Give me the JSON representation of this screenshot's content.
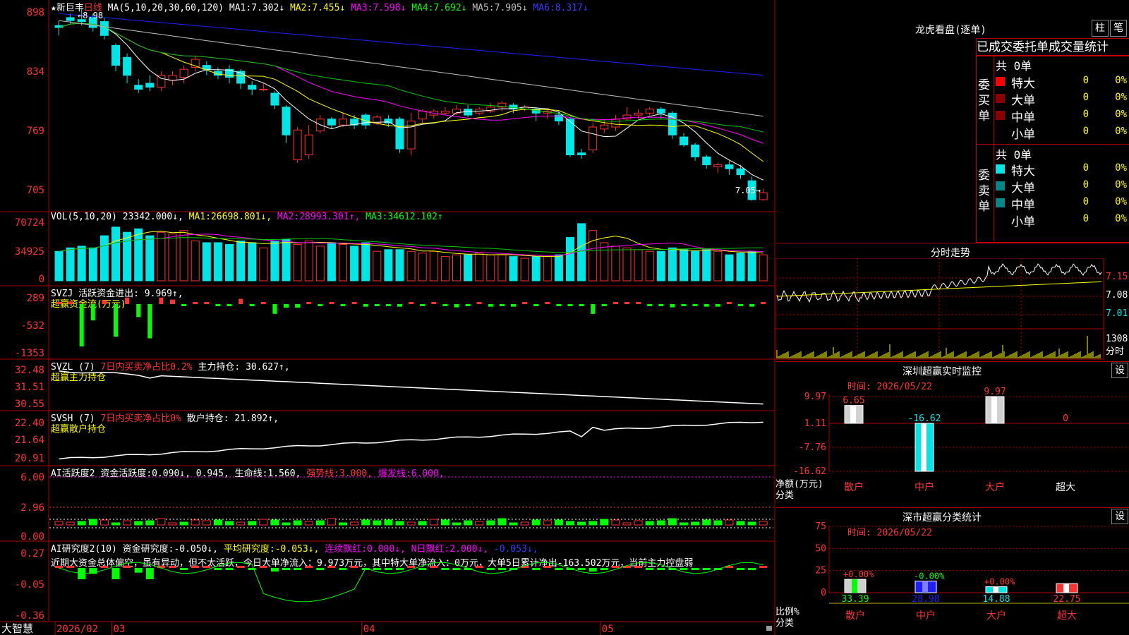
{
  "colors": {
    "up": "#ff3232",
    "down": "#00e6e6",
    "ma1": "#ffffff",
    "ma2": "#ffff00",
    "ma3": "#ff00ff",
    "ma4": "#00c800",
    "ma5": "#c0c0c0",
    "ma6": "#2020ff",
    "frame": "#b00000",
    "inflow": "#ff3232",
    "outflow": "#00ff00"
  },
  "main": {
    "title_star": "★新巨丰",
    "period": "日线",
    "ma_params": "MA(5,10,20,30,60,120)",
    "ma": [
      {
        "label": "MA1:",
        "value": "7.302↓"
      },
      {
        "label": "MA2:",
        "value": "7.455↓"
      },
      {
        "label": "MA3:",
        "value": "7.598↓"
      },
      {
        "label": "MA4:",
        "value": "7.692↓"
      },
      {
        "label": "MA5:",
        "value": "7.905↓"
      },
      {
        "label": "MA6:",
        "value": "8.317↓"
      }
    ],
    "yticks": [
      "898",
      "834",
      "769",
      "705"
    ],
    "high_label": "←8.98",
    "last_label": "7.05→"
  },
  "chart_data": {
    "type": "candlestick",
    "ylim": [
      7.0,
      9.0
    ],
    "candles": [
      [
        8.8,
        8.78,
        8.85,
        8.7
      ],
      [
        8.88,
        8.85,
        8.92,
        8.82
      ],
      [
        8.86,
        8.84,
        8.98,
        8.8
      ],
      [
        8.88,
        8.78,
        8.92,
        8.74
      ],
      [
        8.84,
        8.7,
        8.88,
        8.66
      ],
      [
        8.6,
        8.4,
        8.62,
        8.34
      ],
      [
        8.48,
        8.3,
        8.52,
        8.22
      ],
      [
        8.2,
        8.16,
        8.26,
        8.12
      ],
      [
        8.22,
        8.18,
        8.3,
        8.14
      ],
      [
        8.18,
        8.3,
        8.34,
        8.14
      ],
      [
        8.25,
        8.3,
        8.34,
        8.2
      ],
      [
        8.28,
        8.36,
        8.4,
        8.22
      ],
      [
        8.38,
        8.46,
        8.5,
        8.34
      ],
      [
        8.4,
        8.36,
        8.44,
        8.3
      ],
      [
        8.34,
        8.3,
        8.38,
        8.26
      ],
      [
        8.36,
        8.28,
        8.4,
        8.22
      ],
      [
        8.34,
        8.22,
        8.36,
        8.16
      ],
      [
        8.2,
        8.16,
        8.24,
        8.1
      ],
      [
        8.16,
        8.16,
        8.22,
        8.14
      ],
      [
        8.12,
        8.0,
        8.14,
        7.96
      ],
      [
        7.98,
        7.7,
        8.0,
        7.62
      ],
      [
        7.45,
        7.75,
        7.78,
        7.42
      ],
      [
        7.5,
        7.7,
        7.8,
        7.46
      ],
      [
        7.74,
        7.86,
        7.9,
        7.72
      ],
      [
        7.86,
        7.8,
        7.88,
        7.76
      ],
      [
        7.8,
        7.86,
        7.92,
        7.78
      ],
      [
        7.86,
        7.8,
        7.9,
        7.76
      ],
      [
        7.9,
        7.8,
        7.92,
        7.76
      ],
      [
        7.82,
        7.88,
        7.9,
        7.8
      ],
      [
        7.86,
        7.82,
        7.9,
        7.78
      ],
      [
        7.86,
        7.56,
        7.88,
        7.52
      ],
      [
        7.56,
        7.84,
        7.92,
        7.5
      ],
      [
        7.86,
        7.94,
        7.96,
        7.82
      ],
      [
        7.9,
        7.94,
        7.96,
        7.86
      ],
      [
        7.92,
        7.94,
        7.98,
        7.9
      ],
      [
        7.92,
        7.96,
        8.0,
        7.9
      ],
      [
        7.96,
        7.9,
        8.0,
        7.88
      ],
      [
        7.92,
        7.96,
        7.98,
        7.9
      ],
      [
        7.94,
        7.98,
        8.02,
        7.92
      ],
      [
        7.98,
        8.02,
        8.04,
        7.94
      ],
      [
        8.0,
        7.96,
        8.02,
        7.92
      ],
      [
        7.96,
        7.98,
        8.0,
        7.94
      ],
      [
        7.96,
        7.92,
        7.98,
        7.84
      ],
      [
        7.92,
        7.94,
        7.96,
        7.86
      ],
      [
        7.9,
        7.84,
        7.94,
        7.8
      ],
      [
        7.86,
        7.5,
        7.88,
        7.48
      ],
      [
        7.52,
        7.5,
        7.56,
        7.46
      ],
      [
        7.55,
        7.78,
        7.82,
        7.52
      ],
      [
        7.76,
        7.8,
        7.86,
        7.72
      ],
      [
        7.78,
        7.86,
        7.9,
        7.74
      ],
      [
        7.86,
        7.9,
        7.98,
        7.84
      ],
      [
        7.9,
        7.92,
        7.96,
        7.86
      ],
      [
        7.92,
        7.96,
        7.98,
        7.9
      ],
      [
        7.96,
        7.92,
        7.98,
        7.86
      ],
      [
        7.92,
        7.7,
        7.94,
        7.66
      ],
      [
        7.68,
        7.6,
        7.72,
        7.58
      ],
      [
        7.6,
        7.48,
        7.62,
        7.44
      ],
      [
        7.48,
        7.4,
        7.5,
        7.36
      ],
      [
        7.38,
        7.4,
        7.42,
        7.32
      ],
      [
        7.4,
        7.36,
        7.44,
        7.3
      ],
      [
        7.36,
        7.3,
        7.4,
        7.26
      ],
      [
        7.24,
        7.05,
        7.28,
        7.04
      ],
      [
        7.05,
        7.12,
        7.16,
        7.04
      ]
    ],
    "volume": [
      34,
      38,
      40,
      38,
      52,
      62,
      56,
      60,
      52,
      56,
      54,
      58,
      46,
      44,
      44,
      42,
      46,
      44,
      38,
      46,
      48,
      42,
      46,
      40,
      44,
      42,
      40,
      44,
      34,
      36,
      36,
      34,
      32,
      34,
      28,
      30,
      30,
      32,
      30,
      30,
      28,
      26,
      28,
      28,
      30,
      50,
      66,
      58,
      44,
      40,
      38,
      36,
      34,
      34,
      38,
      36,
      34,
      36,
      34,
      30,
      32,
      34,
      30
    ],
    "vol_ylim": [
      0,
      70724
    ],
    "vol_ticks": [
      "70724",
      "34925",
      "0"
    ],
    "flow": [
      60,
      80,
      -1300,
      -500,
      120,
      -1000,
      200,
      -400,
      -1050,
      200,
      140,
      -60,
      20,
      60,
      -60,
      -60,
      160,
      -60,
      0,
      -300,
      -110,
      -110,
      60,
      -60,
      60,
      -40,
      0,
      -80,
      -60,
      -40,
      -80,
      60,
      -60,
      40,
      -60,
      -100,
      -30,
      0,
      -80,
      -60,
      -80,
      20,
      -60,
      60,
      -40,
      -60,
      -60,
      -300,
      -40,
      0,
      60,
      40,
      -60,
      -40,
      -100,
      -30,
      -60,
      -80,
      -80,
      30,
      -40,
      -80,
      20
    ],
    "flow_ticks": [
      "289",
      "-532",
      "-1353"
    ],
    "svzl_ticks": [
      "32.48",
      "31.51",
      "30.55"
    ],
    "svsh_ticks": [
      "22.40",
      "21.64",
      "20.91"
    ],
    "ai_ticks": [
      "6.00",
      "2.96",
      "0.00"
    ],
    "res_ticks": [
      "0.27",
      "-0.05",
      "-0.36"
    ],
    "xlabels": [
      {
        "t": "2026/02",
        "i": 0
      },
      {
        "t": "03",
        "i": 5
      },
      {
        "t": "04",
        "i": 27
      },
      {
        "t": "05",
        "i": 48
      }
    ]
  },
  "vol": {
    "label": "VOL(5,10,20)",
    "value": "23342.000↓,",
    "ma": [
      {
        "label": "MA1:",
        "value": "26698.801↓,"
      },
      {
        "label": "MA2:",
        "value": "28993.301↑,"
      },
      {
        "label": "MA3:",
        "value": "34612.102↑"
      }
    ]
  },
  "svzj": {
    "label": "SVZJ",
    "text": "活跃资金进出:",
    "value": "9.969↑,",
    "sub": "超赢资金流(万元)"
  },
  "svzl": {
    "label": "SVZL (7)",
    "ratio": "7日内买卖净占比0.2%",
    "text": "主力持仓:",
    "value": "30.627↑,",
    "sub": "超赢主力持仓"
  },
  "svsh": {
    "label": "SVSH (7)",
    "ratio": "7日内买卖净占比0%",
    "text": "散户持仓:",
    "value": "21.892↑,",
    "sub": "超赢散户持仓"
  },
  "ai": {
    "label": "AI活跃度2",
    "t1": "资金活跃度:",
    "v1": "0.090↓,",
    "v2": "0.945,",
    "t3": "生命线:",
    "v3": "1.560,",
    "t4": "强势线:",
    "v4": "3.000,",
    "t5": "爆发线:",
    "v5": "6.000,"
  },
  "res": {
    "label": "AI研究度2(10)",
    "t1": "资金研究度:",
    "v1": "-0.050↓,",
    "t2": "平均研究度:",
    "v2": "-0.053↓,",
    "t3": "连续飘红:",
    "v3": "0.000↓,",
    "t4": "N日飘红:",
    "v4": "2.000↓,",
    "v5": "-0.053↓,",
    "comment": "近期大资金总体偏空，虽有异动，但不太活跃，今日大单净流入：9.973万元，其中特大单净流入：0万元，大单5日累计净出-163.502万元，当前主力控盘弱"
  },
  "bottom": {
    "logo": "大智慧"
  },
  "lhb": {
    "title": "龙虎看盘(逐单)",
    "btn1": "柱",
    "btn2": "笔",
    "tabs": "已成交委托单成交量统计",
    "buy": {
      "side": "委买单",
      "total": "共 0单",
      "rows": [
        {
          "name": "特大",
          "v": "0",
          "p": "0%"
        },
        {
          "name": "大单",
          "v": "0",
          "p": "0%"
        },
        {
          "name": "中单",
          "v": "0",
          "p": "0%"
        },
        {
          "name": "小单",
          "v": "0",
          "p": "0%"
        }
      ]
    },
    "sell": {
      "side": "委卖单",
      "total": "共 0单",
      "rows": [
        {
          "name": "特大",
          "v": "0",
          "p": "0%"
        },
        {
          "name": "大单",
          "v": "0",
          "p": "0%"
        },
        {
          "name": "中单",
          "v": "0",
          "p": "0%"
        },
        {
          "name": "小单",
          "v": "0",
          "p": "0%"
        }
      ]
    }
  },
  "intraday": {
    "title": "分时走势",
    "ticks": [
      "7.15",
      "7.08",
      "7.01"
    ],
    "vol_tick": "1308",
    "vol_label": "分时"
  },
  "monitor": {
    "title": "深圳超赢实时监控",
    "btn": "设",
    "time": "时间: 2026/05/22",
    "yticks": [
      "9.97",
      "1.11",
      "-7.76",
      "-16.62"
    ],
    "ylabel": "净额(万元)",
    "cat_label": "分类",
    "bars": [
      {
        "name": "散户",
        "value": 6.65,
        "label": "6.65"
      },
      {
        "name": "中户",
        "value": -16.62,
        "label": "-16.62"
      },
      {
        "name": "大户",
        "value": 9.97,
        "label": "9.97"
      },
      {
        "name": "超大",
        "value": 0,
        "label": "0"
      }
    ]
  },
  "classify": {
    "title": "深市超赢分类统计",
    "btn": "设",
    "time": "时间: 2026/05/22",
    "yticks": [
      "75",
      "50",
      "25",
      "0"
    ],
    "ylabel": "比例%",
    "cat_label": "分类",
    "bars": [
      {
        "name": "散户",
        "value": 33.39,
        "label": "33.39",
        "delta": "+0.00%"
      },
      {
        "name": "中户",
        "value": 28.98,
        "label": "28.98",
        "delta": "-0.00%"
      },
      {
        "name": "大户",
        "value": 14.88,
        "label": "14.88",
        "delta": "+0.00%"
      },
      {
        "name": "超大",
        "value": 22.75,
        "label": "22.75",
        "delta": ""
      }
    ]
  }
}
